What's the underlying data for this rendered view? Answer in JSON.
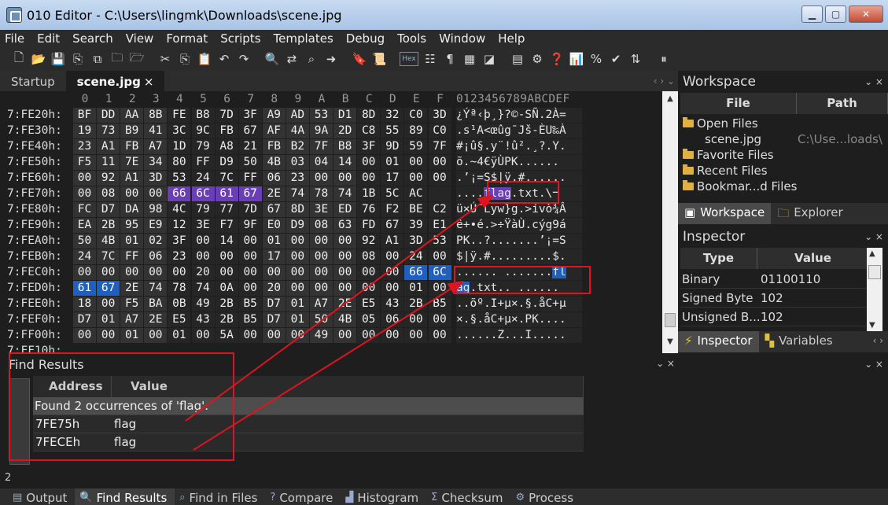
{
  "window": {
    "title": "010 Editor - C:\\Users\\lingmk\\Downloads\\scene.jpg"
  },
  "menu": [
    "File",
    "Edit",
    "Search",
    "View",
    "Format",
    "Scripts",
    "Templates",
    "Debug",
    "Tools",
    "Window",
    "Help"
  ],
  "tabs": [
    {
      "label": "Startup"
    },
    {
      "label": "scene.jpg"
    }
  ],
  "hex": {
    "col_headers": [
      "0",
      "1",
      "2",
      "3",
      "4",
      "5",
      "6",
      "7",
      "8",
      "9",
      "A",
      "B",
      "C",
      "D",
      "E",
      "F"
    ],
    "ascii_header": "0123456789ABCDEF",
    "rows": [
      {
        "addr": "7:FE20h:",
        "bytes": [
          "BF",
          "DD",
          "AA",
          "8B",
          "FE",
          "B8",
          "7D",
          "3F",
          "A9",
          "AD",
          "53",
          "D1",
          "8D",
          "32",
          "C0",
          "3D"
        ],
        "ascii": "¿Ýª‹þ¸}?©-SÑ.2À="
      },
      {
        "addr": "7:FE30h:",
        "bytes": [
          "19",
          "73",
          "B9",
          "41",
          "3C",
          "9C",
          "FB",
          "67",
          "AF",
          "4A",
          "9A",
          "2D",
          "C8",
          "55",
          "89",
          "C0"
        ],
        "ascii": ".s¹A<œûg¯Jš-ÈU‰À"
      },
      {
        "addr": "7:FE40h:",
        "bytes": [
          "23",
          "A1",
          "FB",
          "A7",
          "1D",
          "79",
          "A8",
          "21",
          "FB",
          "B2",
          "7F",
          "B8",
          "3F",
          "9D",
          "59",
          "7F"
        ],
        "ascii": "#¡û§.y¨!û².¸?.Y."
      },
      {
        "addr": "7:FE50h:",
        "bytes": [
          "F5",
          "11",
          "7E",
          "34",
          "80",
          "FF",
          "D9",
          "50",
          "4B",
          "03",
          "04",
          "14",
          "00",
          "01",
          "00",
          "00"
        ],
        "ascii": "õ.~4€ÿÙPK......"
      },
      {
        "addr": "7:FE60h:",
        "bytes": [
          "00",
          "92",
          "A1",
          "3D",
          "53",
          "24",
          "7C",
          "FF",
          "06",
          "23",
          "00",
          "00",
          "00",
          "17",
          "00",
          "00"
        ],
        "ascii": ".’¡=S$|ÿ.#......"
      },
      {
        "addr": "7:FE70h:",
        "bytes": [
          "00",
          "08",
          "00",
          "00",
          "66",
          "6C",
          "61",
          "67",
          "2E",
          "74",
          "78",
          "74",
          "1B",
          "5C",
          "AC",
          ""
        ],
        "ascii": "....flag.txt.\\¬"
      },
      {
        "addr": "7:FE80h:",
        "bytes": [
          "FC",
          "D7",
          "DA",
          "98",
          "4C",
          "79",
          "77",
          "7D",
          "67",
          "8D",
          "3E",
          "ED",
          "76",
          "F2",
          "BE",
          "C2"
        ],
        "ascii": "ü×Ú˜Lyw}g.>ívò¾Â"
      },
      {
        "addr": "7:FE90h:",
        "bytes": [
          "EA",
          "2B",
          "95",
          "E9",
          "12",
          "3E",
          "F7",
          "9F",
          "E0",
          "D9",
          "08",
          "63",
          "FD",
          "67",
          "39",
          "E1"
        ],
        "ascii": "ê+•é.>÷ŸàÙ.cýg9á"
      },
      {
        "addr": "7:FEA0h:",
        "bytes": [
          "50",
          "4B",
          "01",
          "02",
          "3F",
          "00",
          "14",
          "00",
          "01",
          "00",
          "00",
          "00",
          "92",
          "A1",
          "3D",
          "53"
        ],
        "ascii": "PK..?.......’¡=S"
      },
      {
        "addr": "7:FEB0h:",
        "bytes": [
          "24",
          "7C",
          "FF",
          "06",
          "23",
          "00",
          "00",
          "00",
          "17",
          "00",
          "00",
          "00",
          "08",
          "00",
          "24",
          "00"
        ],
        "ascii": "$|ÿ.#.........$."
      },
      {
        "addr": "7:FEC0h:",
        "bytes": [
          "00",
          "00",
          "00",
          "00",
          "00",
          "20",
          "00",
          "00",
          "00",
          "00",
          "00",
          "00",
          "00",
          "00",
          "66",
          "6C"
        ],
        "ascii": "...... .......fl"
      },
      {
        "addr": "7:FED0h:",
        "bytes": [
          "61",
          "67",
          "2E",
          "74",
          "78",
          "74",
          "0A",
          "00",
          "20",
          "00",
          "00",
          "00",
          "00",
          "00",
          "01",
          "00"
        ],
        "ascii": "ag.txt.. ......"
      },
      {
        "addr": "7:FEE0h:",
        "bytes": [
          "18",
          "00",
          "F5",
          "BA",
          "0B",
          "49",
          "2B",
          "B5",
          "D7",
          "01",
          "A7",
          "2E",
          "E5",
          "43",
          "2B",
          "B5"
        ],
        "ascii": "..õº.I+µ×.§.åC+µ"
      },
      {
        "addr": "7:FEF0h:",
        "bytes": [
          "D7",
          "01",
          "A7",
          "2E",
          "E5",
          "43",
          "2B",
          "B5",
          "D7",
          "01",
          "50",
          "4B",
          "05",
          "06",
          "00",
          "00"
        ],
        "ascii": "×.§.åC+µ×.PK...."
      },
      {
        "addr": "7:FF00h:",
        "bytes": [
          "00",
          "00",
          "01",
          "00",
          "01",
          "00",
          "5A",
          "00",
          "00",
          "00",
          "49",
          "00",
          "00",
          "00",
          "00",
          "00"
        ],
        "ascii": "......Z...I....."
      },
      {
        "addr": "7:FF10h:",
        "bytes": [],
        "ascii": ""
      }
    ]
  },
  "find_results": {
    "title": "Find Results",
    "col_address": "Address",
    "col_value": "Value",
    "message": "Found 2 occurrences of 'flag'.",
    "rows": [
      {
        "address": "7FE75h",
        "value": "flag"
      },
      {
        "address": "7FECEh",
        "value": "flag"
      }
    ],
    "count": "2"
  },
  "bottom_tabs": [
    "Output",
    "Find Results",
    "Find in Files",
    "Compare",
    "Histogram",
    "Checksum",
    "Process"
  ],
  "workspace": {
    "title": "Workspace",
    "col_file": "File",
    "col_path": "Path",
    "open_files": "Open Files",
    "file_name": "scene.jpg",
    "file_path": "C:\\Use...loads\\",
    "favorite": "Favorite Files",
    "recent": "Recent Files",
    "bookmarked": "Bookmar...d Files",
    "tab_workspace": "Workspace",
    "tab_explorer": "Explorer"
  },
  "inspector": {
    "title": "Inspector",
    "col_type": "Type",
    "col_value": "Value",
    "rows": [
      {
        "type": "Binary",
        "value": "01100110"
      },
      {
        "type": "Signed Byte",
        "value": "102"
      },
      {
        "type": "Unsigned B...",
        "value": "102"
      }
    ],
    "tab_inspector": "Inspector",
    "tab_variables": "Variables"
  },
  "colors": {
    "selection": "#1f5fbf",
    "highlight": "#6a3fb5",
    "annotation": "#e0141e"
  }
}
